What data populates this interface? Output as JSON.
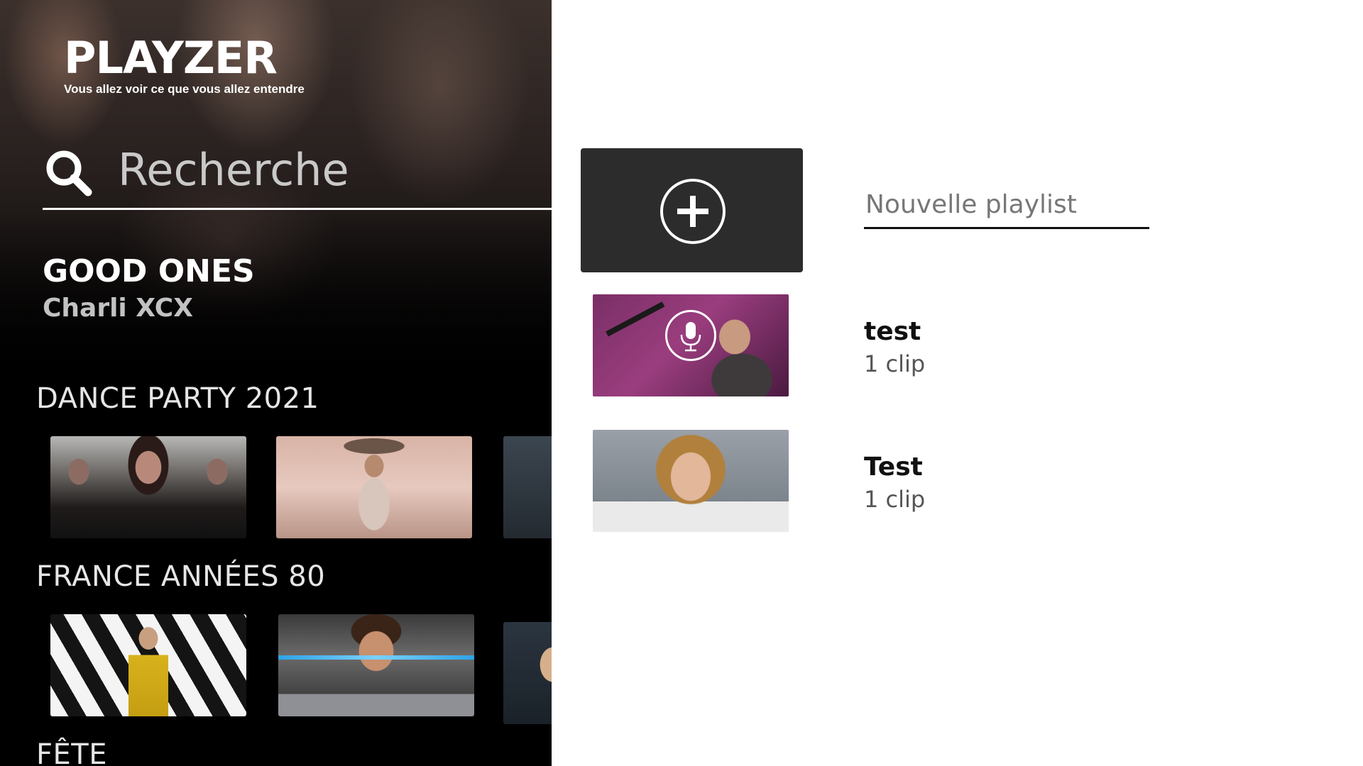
{
  "app": {
    "logo_text": "PLAYZER",
    "tagline": "Vous allez voir ce que vous allez entendre"
  },
  "search": {
    "placeholder": "Recherche",
    "icon": "search-icon"
  },
  "now_playing": {
    "title": "GOOD ONES",
    "artist": "Charli XCX"
  },
  "categories": [
    {
      "title": "DANCE PARTY 2021"
    },
    {
      "title": "FRANCE ANNÉES 80"
    },
    {
      "title": "FÊTE"
    }
  ],
  "playlist_panel": {
    "new_playlist_placeholder": "Nouvelle playlist",
    "add_icon": "plus-circle-icon",
    "playlists": [
      {
        "name": "test",
        "count": "1 clip",
        "icon": "microphone-icon"
      },
      {
        "name": "Test",
        "count": "1 clip"
      }
    ]
  },
  "colors": {
    "panel_dark": "#000000",
    "button_dark": "#2c2c2c",
    "text_white": "#ffffff",
    "text_gray": "#c2c2c2"
  }
}
